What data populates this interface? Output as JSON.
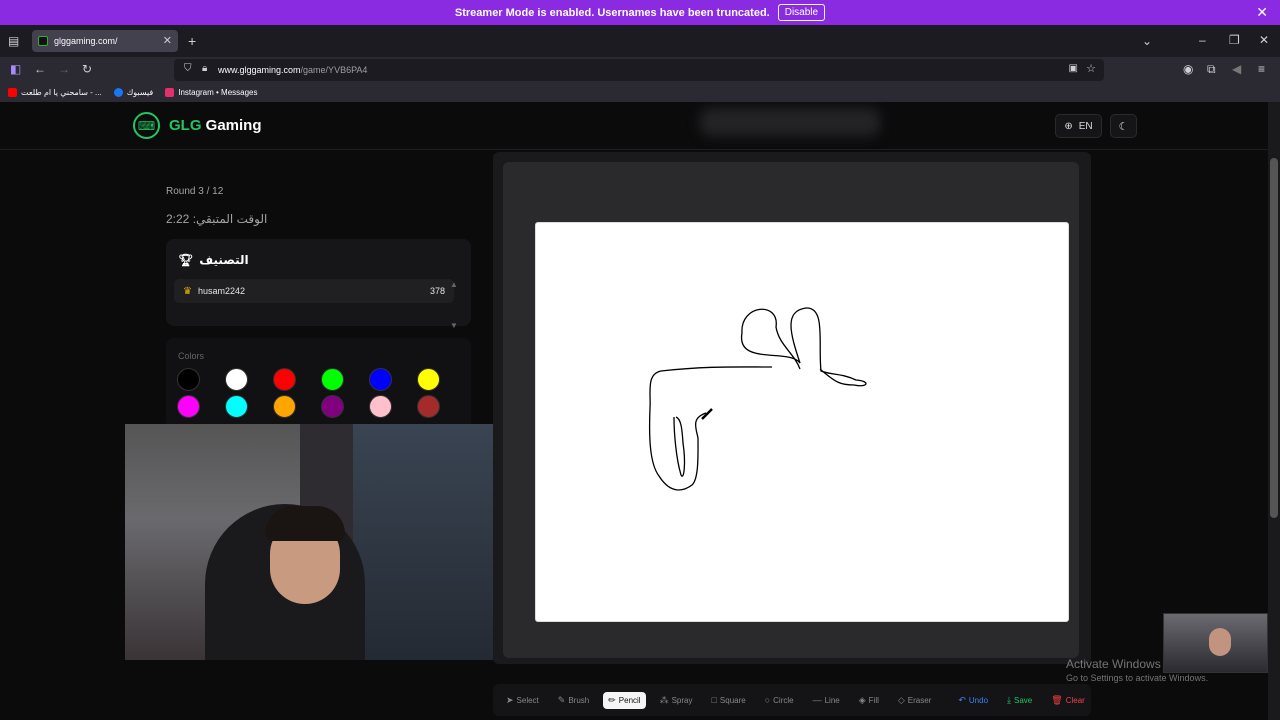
{
  "banner": {
    "text": "Streamer Mode is enabled. Usernames have been truncated.",
    "button": "Disable"
  },
  "browser": {
    "tab_title": "glggaming.com/",
    "url_host": "www.glggaming.com",
    "url_path": "/game/YVB6PA4",
    "bookmarks": [
      {
        "label": "سامحني يا ام طلعت - ...",
        "color": "#ff0000"
      },
      {
        "label": "فيسبوك",
        "color": "#1877f2"
      },
      {
        "label": "Instagram • Messages",
        "color": "#e1306c"
      }
    ]
  },
  "site": {
    "brand_prefix": "GLG",
    "brand_suffix": " Gaming",
    "lang": "EN"
  },
  "game": {
    "round": "Round 3 / 12",
    "timer": "الوقت المتبقي: 2:22",
    "ranking_title": "التصنيف",
    "players": [
      {
        "name": "husam2242",
        "score": "378"
      }
    ],
    "colors_label": "Colors",
    "palette": [
      "#000000",
      "#ffffff",
      "#ff0000",
      "#00ff00",
      "#0000ff",
      "#ffff00",
      "#ff00ff",
      "#00ffff",
      "#ffa500",
      "#800080",
      "#ffc0cb",
      "#a52a2a"
    ]
  },
  "toolbar": {
    "select": "Select",
    "brush": "Brush",
    "pencil": "Pencil",
    "spray": "Spray",
    "square": "Square",
    "circle": "Circle",
    "line": "Line",
    "fill": "Fill",
    "eraser": "Eraser",
    "undo": "Undo",
    "save": "Save",
    "clear": "Clear"
  },
  "watermark": {
    "title": "Activate Windows",
    "sub": "Go to Settings to activate Windows."
  }
}
